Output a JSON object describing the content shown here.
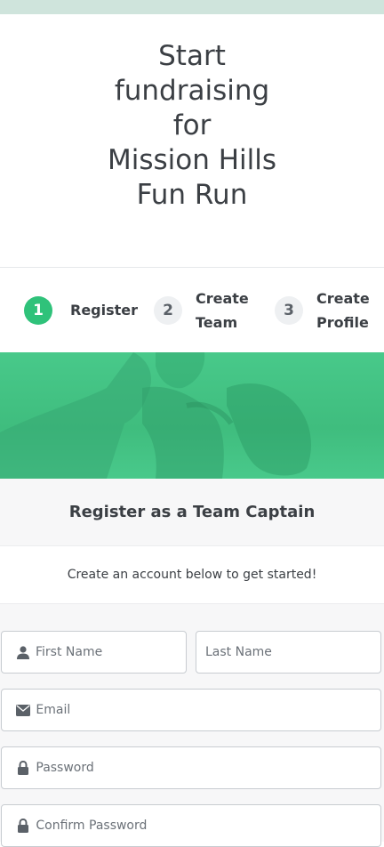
{
  "hero": {
    "title_lines": [
      "Start",
      "fundraising",
      "for",
      "Mission Hills",
      "Fun Run"
    ]
  },
  "steps": [
    {
      "number": "1",
      "label_lines": [
        "Register"
      ],
      "state": "active"
    },
    {
      "number": "2",
      "label_lines": [
        "Create",
        "Team"
      ],
      "state": "inactive"
    },
    {
      "number": "3",
      "label_lines": [
        "Create",
        "Profile"
      ],
      "state": "inactive"
    }
  ],
  "section": {
    "heading": "Register as a Team Captain",
    "subheading": "Create an account below to get started!"
  },
  "form": {
    "first_name_placeholder": "First Name",
    "last_name_placeholder": "Last Name",
    "email_placeholder": "Email",
    "password_placeholder": "Password",
    "confirm_password_placeholder": "Confirm Password"
  },
  "icons": {
    "first_name": "user-icon",
    "email": "envelope-icon",
    "password": "lock-icon",
    "confirm_password": "lock-icon"
  },
  "colors": {
    "accent": "#2fc27a",
    "banner": "#44c485"
  }
}
